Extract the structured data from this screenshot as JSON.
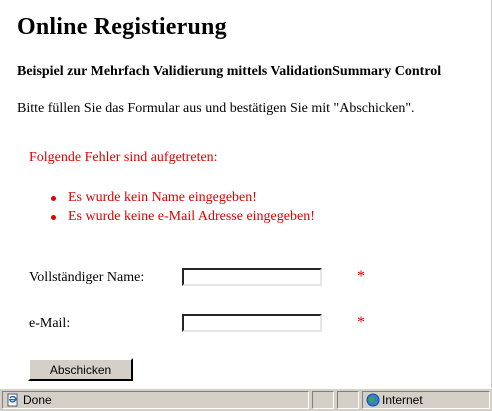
{
  "page": {
    "title": "Online Registierung",
    "subtitle": "Beispiel zur Mehrfach Validierung mittels ValidationSummary Control",
    "intro": "Bitte füllen Sie das Formular aus und bestätigen Sie mit \"Abschicken\"."
  },
  "summary": {
    "header": "Folgende Fehler sind aufgetreten:",
    "errors": [
      "Es wurde kein Name eingegeben!",
      "Es wurde keine e-Mail Adresse eingegeben!"
    ],
    "color": "#e00000"
  },
  "form": {
    "name_label": "Vollständiger Name:",
    "name_value": "",
    "mail_label": "e-Mail:",
    "mail_value": "",
    "required_marker": "*",
    "submit_label": "Abschicken"
  },
  "statusbar": {
    "status": "Done",
    "zone": "Internet",
    "icons": {
      "status": "ie-page-icon",
      "zone": "globe-icon"
    }
  }
}
